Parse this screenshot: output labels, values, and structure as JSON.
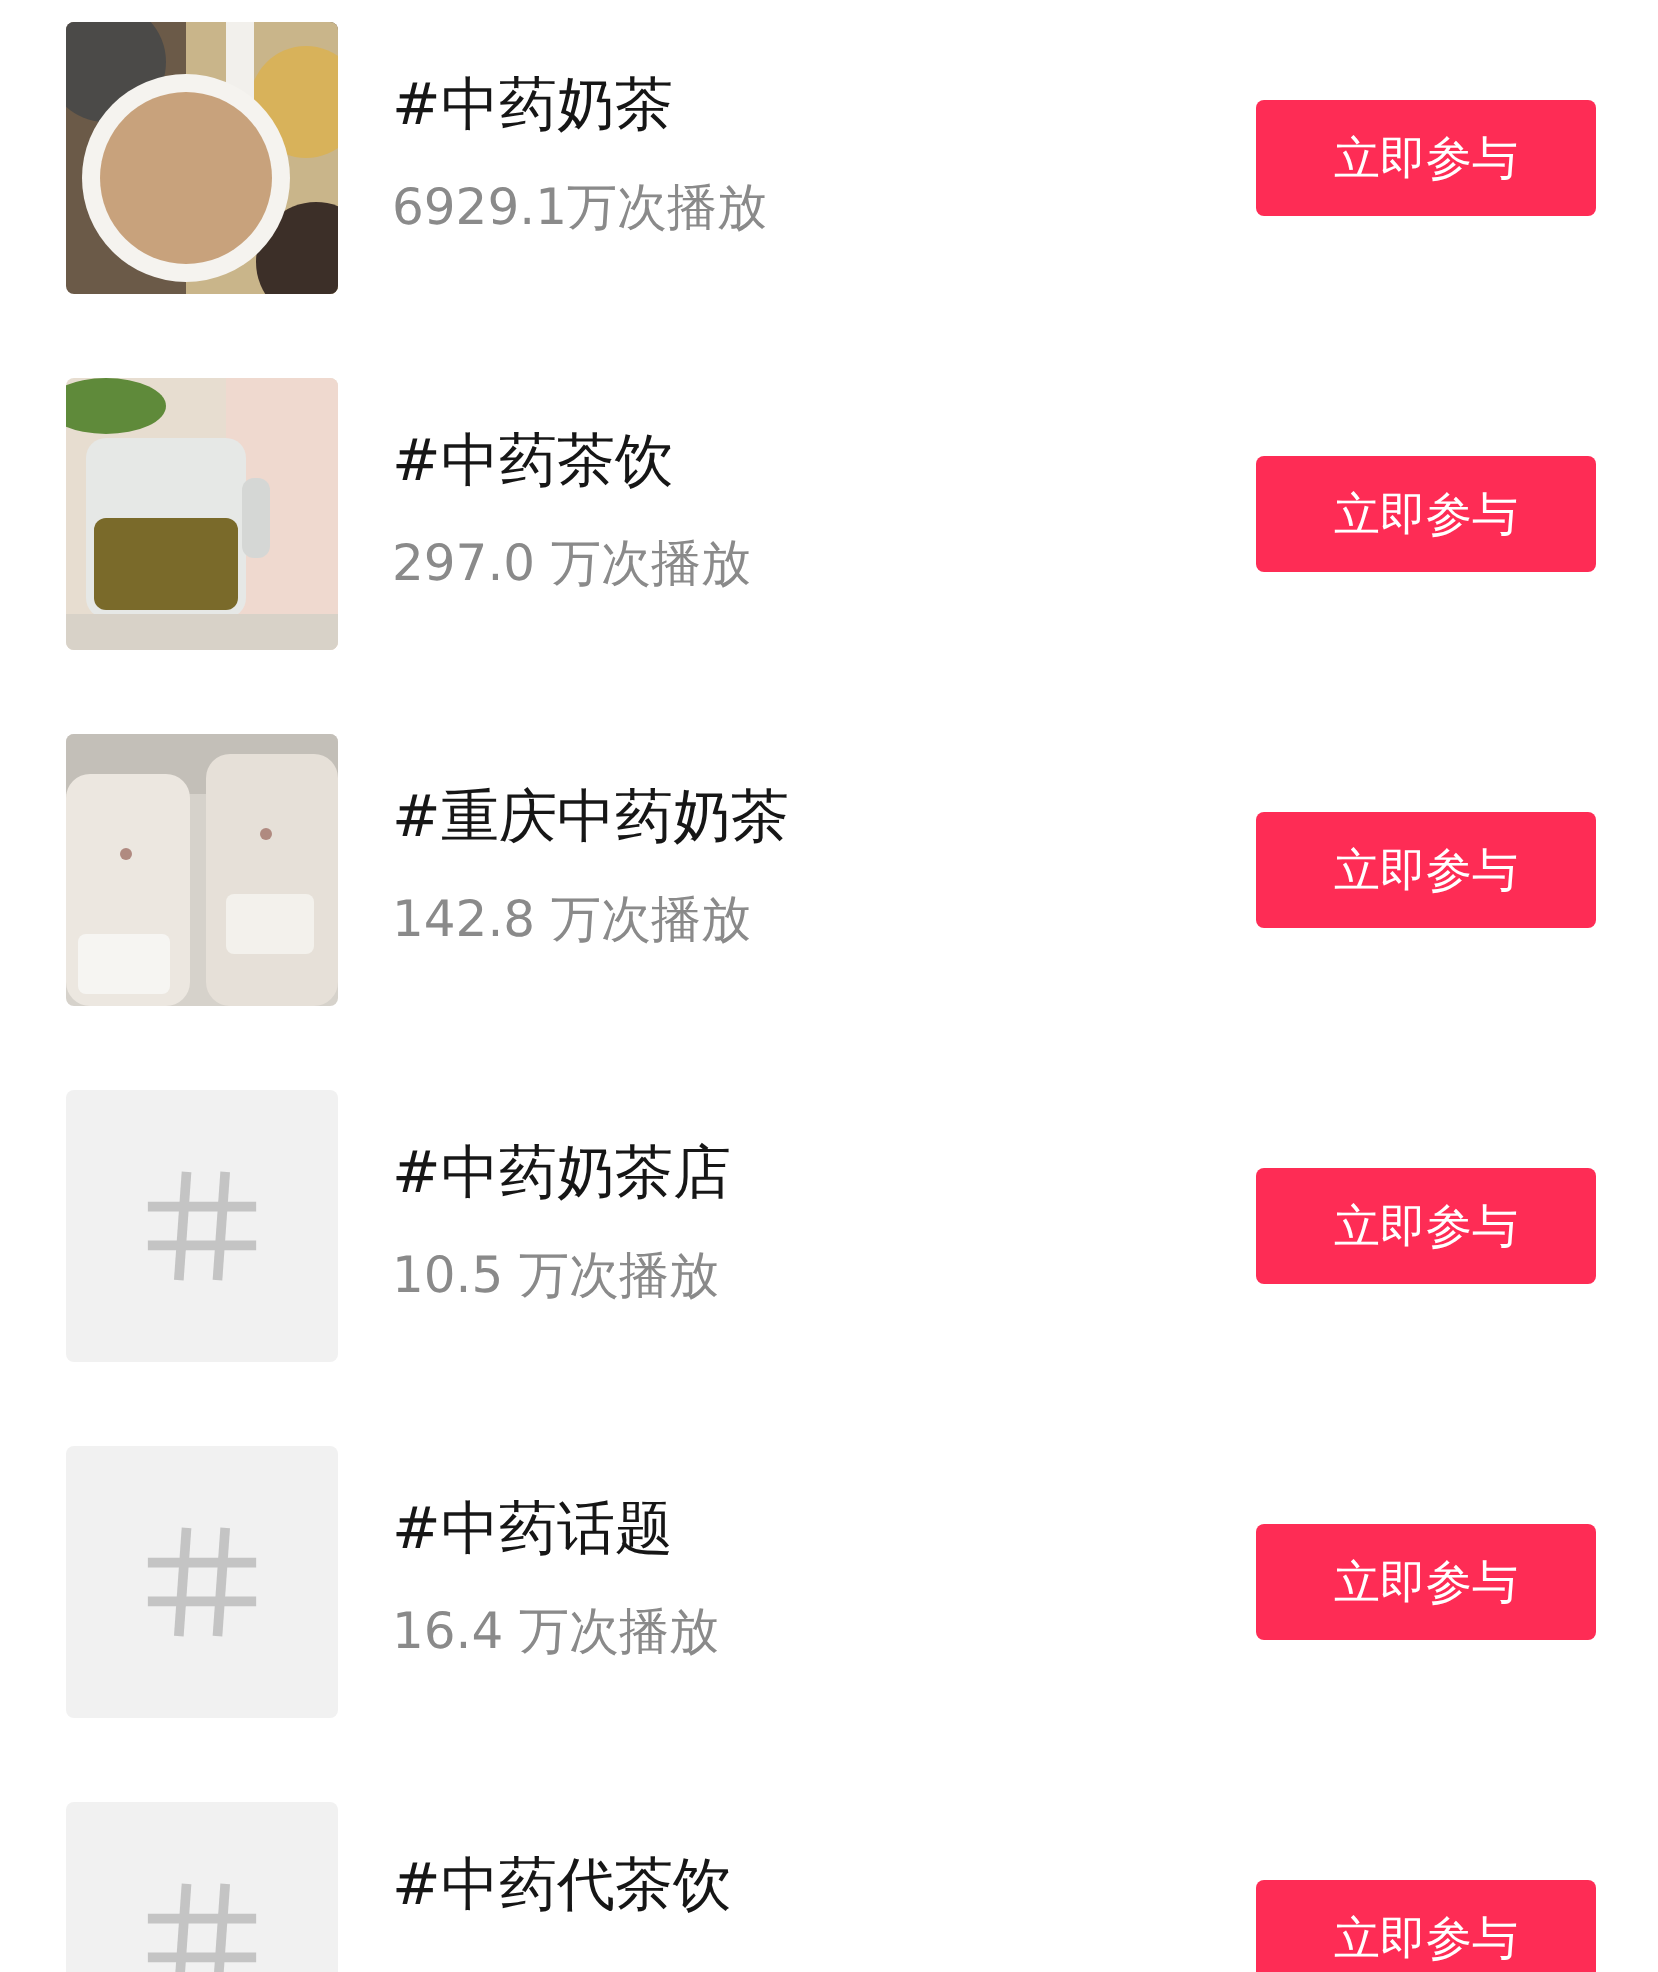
{
  "topics": [
    {
      "title": "#中药奶茶",
      "plays": "6929.1万次播放",
      "button": "立即参与"
    },
    {
      "title": "#中药茶饮",
      "plays": "297.0 万次播放",
      "button": "立即参与"
    },
    {
      "title": "#重庆中药奶茶",
      "plays": "142.8 万次播放",
      "button": "立即参与"
    },
    {
      "thumbnail": {
        "kind": "hashtag"
      },
      "title": "#中药奶茶店",
      "plays": "10.5 万次播放",
      "button": "立即参与"
    },
    {
      "thumbnail": {
        "kind": "hashtag"
      },
      "title": "#中药话题",
      "plays": "16.4 万次播放",
      "button": "立即参与"
    },
    {
      "thumbnail": {
        "kind": "hashtag"
      },
      "title": "#中药代茶饮",
      "button": "立即参与"
    }
  ]
}
